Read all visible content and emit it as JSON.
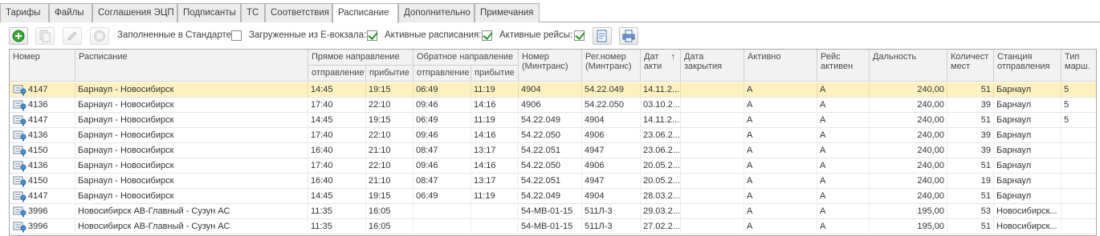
{
  "tabs": [
    {
      "label": "Тарифы",
      "active": false
    },
    {
      "label": "Файлы",
      "active": false
    },
    {
      "label": "Соглашения ЭЦП",
      "active": false
    },
    {
      "label": "Подписанты",
      "active": false
    },
    {
      "label": "ТС",
      "active": false
    },
    {
      "label": "Соответствия",
      "active": false
    },
    {
      "label": "Расписание",
      "active": true
    },
    {
      "label": "Дополнительно",
      "active": false
    },
    {
      "label": "Примечания",
      "active": false
    }
  ],
  "toolbar": {
    "add_icon": "plus-circle-icon",
    "copy_icon": "copy-icon",
    "edit_icon": "pencil-icon",
    "delete_icon": "delete-circle-icon",
    "filled_in_standard_label": "Заполненные в Стандарте:",
    "filled_in_standard_checked": false,
    "loaded_from_evokzal_label": "Загруженные из Е-вокзала:",
    "loaded_from_evokzal_checked": true,
    "active_schedules_label": "Активные расписания:",
    "active_schedules_checked": true,
    "active_trips_label": "Активные рейсы:",
    "active_trips_checked": true,
    "report_icon": "report-icon",
    "print_icon": "print-icon"
  },
  "colors": {
    "selected_row": "#fdf1c2",
    "header_bg": "#f2f2f2",
    "add_green": "#3aa83a",
    "check_green": "#2a9a2a"
  },
  "grid": {
    "headers": {
      "number": "Номер",
      "schedule": "Расписание",
      "forward": "Прямое направление",
      "forward_depart": "отправление",
      "forward_arrive": "прибытие",
      "backward": "Обратное направление",
      "backward_depart": "отправление",
      "backward_arrive": "прибытие",
      "num_mintrans": "Номер (Минтранс)",
      "reg_num_mintrans": "Рег.номер (Минтранс)",
      "date_active": "Дат акти",
      "sort_indicator": "↑",
      "date_close": "Дата закрытия",
      "active": "Активно",
      "trip_active": "Рейс активен",
      "distance": "Дальность",
      "seats": "Количест мест",
      "station": "Станция отправления",
      "route_type": "Тип марш."
    },
    "row_icon": "route-doc-icon",
    "rows": [
      {
        "number": "4147",
        "schedule": "Барнаул - Новосибирск",
        "fd": "14:45",
        "fa": "19:15",
        "bd": "06:49",
        "ba": "11:19",
        "num": "4904",
        "reg": "54.22.049",
        "date": "14.11.2...",
        "close": "",
        "active": "А",
        "trip": "А",
        "dist": "240,00",
        "seats": "51",
        "station": "Барнаул",
        "type": "5",
        "selected": true
      },
      {
        "number": "4136",
        "schedule": "Барнаул - Новосибирск",
        "fd": "17:40",
        "fa": "22:10",
        "bd": "09:46",
        "ba": "14:16",
        "num": "4906",
        "reg": "54.22.050",
        "date": "03.10.2...",
        "close": "",
        "active": "А",
        "trip": "А",
        "dist": "240,00",
        "seats": "39",
        "station": "Барнаул",
        "type": "5",
        "selected": false
      },
      {
        "number": "4147",
        "schedule": "Барнаул - Новосибирск",
        "fd": "14:45",
        "fa": "19:15",
        "bd": "06:49",
        "ba": "11:19",
        "num": "54.22.049",
        "reg": "4904",
        "date": "14.11.2...",
        "close": "",
        "active": "А",
        "trip": "А",
        "dist": "240,00",
        "seats": "51",
        "station": "Барнаул",
        "type": "5",
        "selected": false
      },
      {
        "number": "4136",
        "schedule": "Барнаул - Новосибирск",
        "fd": "17:40",
        "fa": "22:10",
        "bd": "09:46",
        "ba": "14:16",
        "num": "54.22.050",
        "reg": "4906",
        "date": "23.06.2...",
        "close": "",
        "active": "А",
        "trip": "А",
        "dist": "240,00",
        "seats": "39",
        "station": "Барнаул",
        "type": "",
        "selected": false
      },
      {
        "number": "4150",
        "schedule": "Барнаул - Новосибирск",
        "fd": "16:40",
        "fa": "21:10",
        "bd": "08:47",
        "ba": "13:17",
        "num": "54.22.051",
        "reg": "4947",
        "date": "23.06.2...",
        "close": "",
        "active": "А",
        "trip": "А",
        "dist": "240,00",
        "seats": "39",
        "station": "Барнаул",
        "type": "",
        "selected": false
      },
      {
        "number": "4136",
        "schedule": "Барнаул - Новосибирск",
        "fd": "17:40",
        "fa": "22:10",
        "bd": "09:46",
        "ba": "14:16",
        "num": "54.22.050",
        "reg": "4906",
        "date": "20.05.2...",
        "close": "",
        "active": "А",
        "trip": "А",
        "dist": "240,00",
        "seats": "51",
        "station": "Барнаул",
        "type": "",
        "selected": false
      },
      {
        "number": "4150",
        "schedule": "Барнаул - Новосибирск",
        "fd": "16:40",
        "fa": "21:10",
        "bd": "08:47",
        "ba": "13:17",
        "num": "54.22.051",
        "reg": "4947",
        "date": "20.05.2...",
        "close": "",
        "active": "А",
        "trip": "А",
        "dist": "240,00",
        "seats": "19",
        "station": "Барнаул",
        "type": "",
        "selected": false
      },
      {
        "number": "4147",
        "schedule": "Барнаул - Новосибирск",
        "fd": "14:45",
        "fa": "19:15",
        "bd": "06:49",
        "ba": "11:19",
        "num": "54.22.049",
        "reg": "4904",
        "date": "28.03.2...",
        "close": "",
        "active": "А",
        "trip": "А",
        "dist": "240,00",
        "seats": "51",
        "station": "Барнаул",
        "type": "",
        "selected": false
      },
      {
        "number": "3996",
        "schedule": "Новосибирск АВ-Главный - Сузун АС",
        "fd": "11:35",
        "fa": "16:05",
        "bd": "",
        "ba": "",
        "num": "54-МВ-01-15",
        "reg": "511Л-3",
        "date": "29.03.2...",
        "close": "",
        "active": "А",
        "trip": "А",
        "dist": "195,00",
        "seats": "53",
        "station": "Новосибирск...",
        "type": "",
        "selected": false
      },
      {
        "number": "3996",
        "schedule": "Новосибирск АВ-Главный - Сузун АС",
        "fd": "11:35",
        "fa": "16:05",
        "bd": "",
        "ba": "",
        "num": "54-МВ-01-15",
        "reg": "511Л-3",
        "date": "27.02.2...",
        "close": "",
        "active": "А",
        "trip": "А",
        "dist": "195,00",
        "seats": "51",
        "station": "Новосибирск...",
        "type": "",
        "selected": false
      }
    ]
  }
}
